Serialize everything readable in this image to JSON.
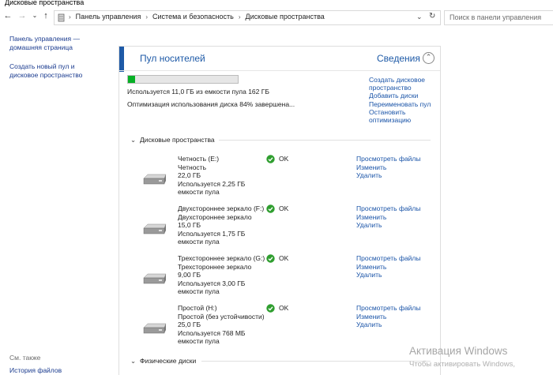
{
  "window": {
    "title": "Дисковые пространства"
  },
  "address": {
    "crumbs": [
      "Панель управления",
      "Система и безопасность",
      "Дисковые пространства"
    ],
    "search_placeholder": "Поиск в панели управления"
  },
  "sidebar": {
    "home_link": [
      "Панель управления —",
      "домашняя страница"
    ],
    "create_link": [
      "Создать новый пул и",
      "дисковое пространство"
    ],
    "see_also": "См. также",
    "history": "История файлов"
  },
  "pool": {
    "title": "Пул носителей",
    "details_label": "Сведения",
    "usage_fraction": 0.068,
    "usage_text": "Используется 11,0 ГБ из емкости пула 162 ГБ",
    "optimization_text": "Оптимизация использования диска 84% завершена...",
    "actions": [
      [
        "Создать дисковое",
        "пространство"
      ],
      [
        "Добавить диски"
      ],
      [
        "Переименовать пул"
      ],
      [
        "Остановить",
        "оптимизацию"
      ]
    ],
    "spaces_section": "Дисковые пространства",
    "physical_section": "Физические диски",
    "spaces": [
      {
        "name": "Четность (E:)",
        "type": "Четность",
        "size": "22,0 ГБ",
        "used": "Используется 2,25 ГБ",
        "used2": "емкости пула",
        "status": "OK",
        "links": [
          "Просмотреть файлы",
          "Изменить",
          "Удалить"
        ]
      },
      {
        "name": "Двухстороннее зеркало (F:)",
        "type": "Двухстороннее зеркало",
        "size": "15,0 ГБ",
        "used": "Используется 1,75 ГБ",
        "used2": "емкости пула",
        "status": "OK",
        "links": [
          "Просмотреть файлы",
          "Изменить",
          "Удалить"
        ]
      },
      {
        "name": "Трехстороннее зеркало (G:)",
        "type": "Трехстороннее зеркало",
        "size": "9,00 ГБ",
        "used": "Используется 3,00 ГБ",
        "used2": "емкости пула",
        "status": "OK",
        "links": [
          "Просмотреть файлы",
          "Изменить",
          "Удалить"
        ]
      },
      {
        "name": "Простой (H:)",
        "type": "Простой (без устойчивости)",
        "size": "25,0 ГБ",
        "used": "Используется 768 МБ",
        "used2": "емкости пула",
        "status": "OK",
        "links": [
          "Просмотреть файлы",
          "Изменить",
          "Удалить"
        ]
      }
    ]
  },
  "watermark": {
    "line1": "Активация Windows",
    "line2": "Чтобы активировать Windows,"
  },
  "colors": {
    "accent": "#1e5aa7",
    "progress": "#06b025",
    "link": "#1a54a8",
    "ok": "#2f9e2f"
  }
}
